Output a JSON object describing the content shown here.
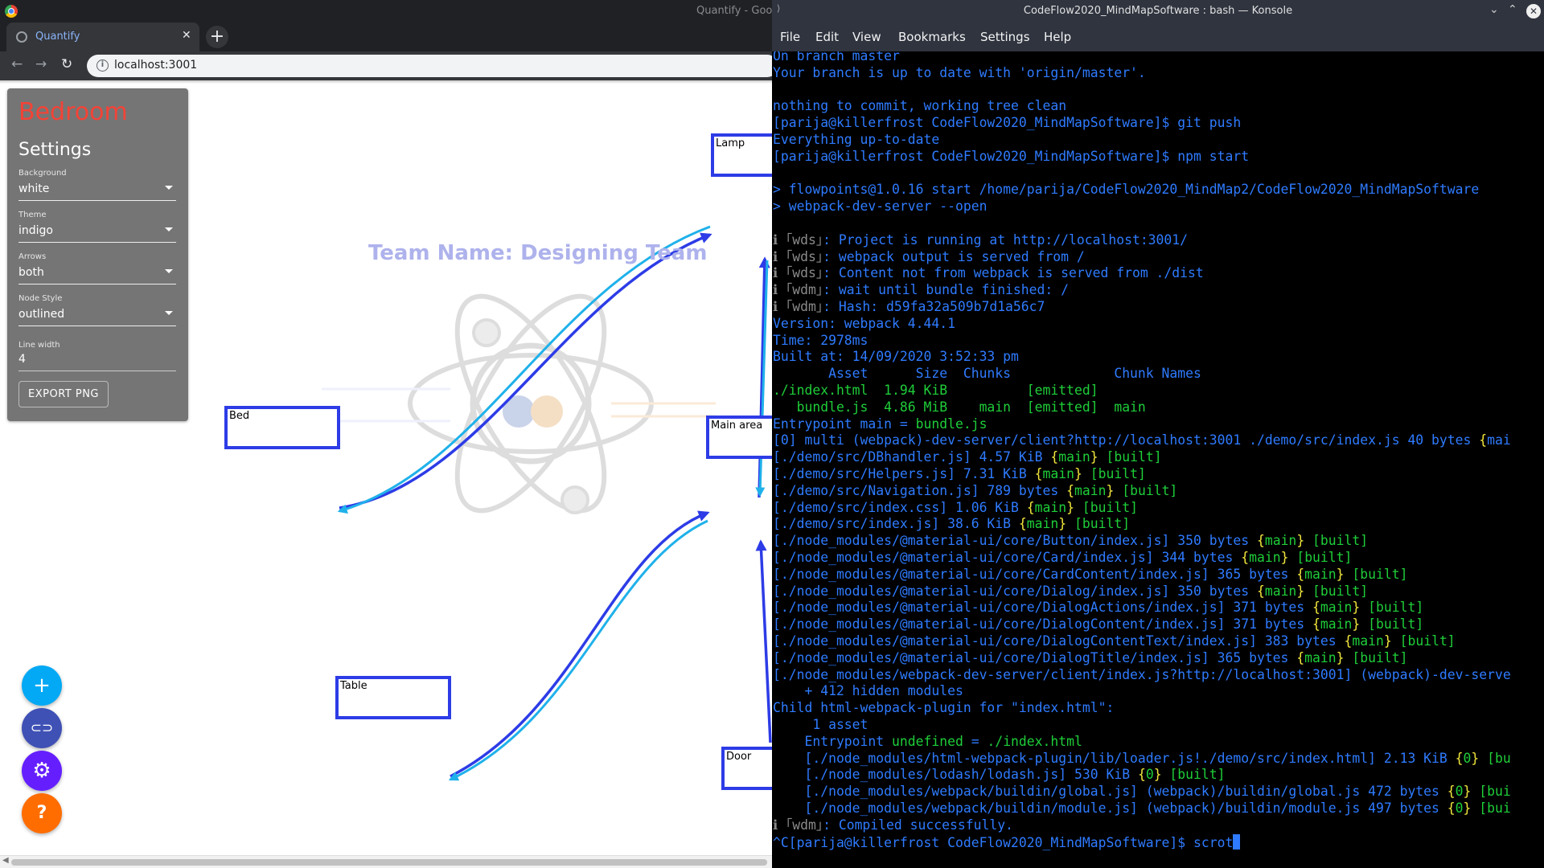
{
  "chrome": {
    "window_title": "Quantify - Goog",
    "tab_title": "Quantify",
    "url": "localhost:3001"
  },
  "app": {
    "settings": {
      "title": "Bedroom",
      "subtitle": "Settings",
      "fields": [
        {
          "label": "Background",
          "value": "white"
        },
        {
          "label": "Theme",
          "value": "indigo"
        },
        {
          "label": "Arrows",
          "value": "both"
        },
        {
          "label": "Node Style",
          "value": "outlined"
        }
      ],
      "line_width_label": "Line width",
      "line_width_value": "4",
      "export_label": "EXPORT PNG"
    },
    "team_name": "Team Name: Designing Team",
    "nodes": [
      "Lamp",
      "Bed",
      "Main area",
      "Table",
      "Door"
    ],
    "fabs": [
      {
        "icon": "plus-icon",
        "glyph": "+",
        "color": "#03a9f4"
      },
      {
        "icon": "link-icon",
        "glyph": "⊂⊃",
        "color": "#3f51b5"
      },
      {
        "icon": "gear-icon",
        "glyph": "⚙",
        "color": "#651fff"
      },
      {
        "icon": "help-icon",
        "glyph": "?",
        "color": "#ff6d00"
      }
    ],
    "colors": {
      "node_border": "#2d3ce6",
      "arrow_dark": "#2d3ce6",
      "arrow_light": "#1fb1ea",
      "accent_title": "#f44336"
    }
  },
  "konsole": {
    "title": "CodeFlow2020_MindMapSoftware : bash — Konsole",
    "menu": [
      "File",
      "Edit",
      "View",
      "Bookmarks",
      "Settings",
      "Help"
    ],
    "lines": [
      [
        [
          "c-blue",
          "On branch master"
        ]
      ],
      [
        [
          "c-blue",
          "Your branch is up to date with 'origin/master'."
        ]
      ],
      [
        [
          "c-blue",
          ""
        ]
      ],
      [
        [
          "c-blue",
          "nothing to commit, working tree clean"
        ]
      ],
      [
        [
          "c-blue",
          "[parija@killerfrost CodeFlow2020_MindMapSoftware]$ git push"
        ]
      ],
      [
        [
          "c-blue",
          "Everything up-to-date"
        ]
      ],
      [
        [
          "c-blue",
          "[parija@killerfrost CodeFlow2020_MindMapSoftware]$ npm start"
        ]
      ],
      [
        [
          "c-blue",
          ""
        ]
      ],
      [
        [
          "c-blue",
          "> flowpoints@1.0.16 start /home/parija/CodeFlow2020_MindMap2/CodeFlow2020_MindMapSoftware"
        ]
      ],
      [
        [
          "c-blue",
          "> webpack-dev-server --open"
        ]
      ],
      [
        [
          "c-blue",
          ""
        ]
      ],
      [
        [
          "c-gray",
          "ℹ ｢wds｣"
        ],
        [
          "c-blue",
          ": Project is running at http://localhost:3001/"
        ]
      ],
      [
        [
          "c-gray",
          "ℹ ｢wds｣"
        ],
        [
          "c-blue",
          ": webpack output is served from /"
        ]
      ],
      [
        [
          "c-gray",
          "ℹ ｢wds｣"
        ],
        [
          "c-blue",
          ": Content not from webpack is served from ./dist"
        ]
      ],
      [
        [
          "c-gray",
          "ℹ ｢wdm｣"
        ],
        [
          "c-blue",
          ": wait until bundle finished: /"
        ]
      ],
      [
        [
          "c-gray",
          "ℹ ｢wdm｣"
        ],
        [
          "c-blue",
          ": Hash: d59fa32a509b7d1a56c7"
        ]
      ],
      [
        [
          "c-blue",
          "Version: webpack 4.44.1"
        ]
      ],
      [
        [
          "c-blue",
          "Time: 2978ms"
        ]
      ],
      [
        [
          "c-blue",
          "Built at: 14/09/2020 3:52:33 pm"
        ]
      ],
      [
        [
          "c-blue",
          "       Asset      Size  Chunks             Chunk Names"
        ]
      ],
      [
        [
          "c-green",
          "./index.html  1.94 KiB          [emitted]"
        ]
      ],
      [
        [
          "c-green",
          "   bundle.js  4.86 MiB    main  [emitted]  main"
        ]
      ],
      [
        [
          "c-blue",
          "Entrypoint main = "
        ],
        [
          "c-green",
          "bundle.js"
        ]
      ],
      [
        [
          "c-blue",
          "[0] multi (webpack)-dev-server/client?http://localhost:3001 ./demo/src/index.js 40 bytes "
        ],
        [
          "c-yellow",
          "{"
        ],
        [
          "c-blue",
          "mai"
        ]
      ],
      [
        [
          "c-blue",
          "[./demo/src/DBhandler.js] 4.57 KiB "
        ],
        [
          "c-yellow",
          "{"
        ],
        [
          "c-green",
          "main"
        ],
        [
          "c-yellow",
          "}"
        ],
        [
          "c-green",
          " [built]"
        ]
      ],
      [
        [
          "c-blue",
          "[./demo/src/Helpers.js] 7.31 KiB "
        ],
        [
          "c-yellow",
          "{"
        ],
        [
          "c-green",
          "main"
        ],
        [
          "c-yellow",
          "}"
        ],
        [
          "c-green",
          " [built]"
        ]
      ],
      [
        [
          "c-blue",
          "[./demo/src/Navigation.js] 789 bytes "
        ],
        [
          "c-yellow",
          "{"
        ],
        [
          "c-green",
          "main"
        ],
        [
          "c-yellow",
          "}"
        ],
        [
          "c-green",
          " [built]"
        ]
      ],
      [
        [
          "c-blue",
          "[./demo/src/index.css] 1.06 KiB "
        ],
        [
          "c-yellow",
          "{"
        ],
        [
          "c-green",
          "main"
        ],
        [
          "c-yellow",
          "}"
        ],
        [
          "c-green",
          " [built]"
        ]
      ],
      [
        [
          "c-blue",
          "[./demo/src/index.js] 38.6 KiB "
        ],
        [
          "c-yellow",
          "{"
        ],
        [
          "c-green",
          "main"
        ],
        [
          "c-yellow",
          "}"
        ],
        [
          "c-green",
          " [built]"
        ]
      ],
      [
        [
          "c-blue",
          "[./node_modules/@material-ui/core/Button/index.js] 350 bytes "
        ],
        [
          "c-yellow",
          "{"
        ],
        [
          "c-green",
          "main"
        ],
        [
          "c-yellow",
          "}"
        ],
        [
          "c-green",
          " [built]"
        ]
      ],
      [
        [
          "c-blue",
          "[./node_modules/@material-ui/core/Card/index.js] 344 bytes "
        ],
        [
          "c-yellow",
          "{"
        ],
        [
          "c-green",
          "main"
        ],
        [
          "c-yellow",
          "}"
        ],
        [
          "c-green",
          " [built]"
        ]
      ],
      [
        [
          "c-blue",
          "[./node_modules/@material-ui/core/CardContent/index.js] 365 bytes "
        ],
        [
          "c-yellow",
          "{"
        ],
        [
          "c-green",
          "main"
        ],
        [
          "c-yellow",
          "}"
        ],
        [
          "c-green",
          " [built]"
        ]
      ],
      [
        [
          "c-blue",
          "[./node_modules/@material-ui/core/Dialog/index.js] 350 bytes "
        ],
        [
          "c-yellow",
          "{"
        ],
        [
          "c-green",
          "main"
        ],
        [
          "c-yellow",
          "}"
        ],
        [
          "c-green",
          " [built]"
        ]
      ],
      [
        [
          "c-blue",
          "[./node_modules/@material-ui/core/DialogActions/index.js] 371 bytes "
        ],
        [
          "c-yellow",
          "{"
        ],
        [
          "c-green",
          "main"
        ],
        [
          "c-yellow",
          "}"
        ],
        [
          "c-green",
          " [built]"
        ]
      ],
      [
        [
          "c-blue",
          "[./node_modules/@material-ui/core/DialogContent/index.js] 371 bytes "
        ],
        [
          "c-yellow",
          "{"
        ],
        [
          "c-green",
          "main"
        ],
        [
          "c-yellow",
          "}"
        ],
        [
          "c-green",
          " [built]"
        ]
      ],
      [
        [
          "c-blue",
          "[./node_modules/@material-ui/core/DialogContentText/index.js] 383 bytes "
        ],
        [
          "c-yellow",
          "{"
        ],
        [
          "c-green",
          "main"
        ],
        [
          "c-yellow",
          "}"
        ],
        [
          "c-green",
          " [built]"
        ]
      ],
      [
        [
          "c-blue",
          "[./node_modules/@material-ui/core/DialogTitle/index.js] 365 bytes "
        ],
        [
          "c-yellow",
          "{"
        ],
        [
          "c-green",
          "main"
        ],
        [
          "c-yellow",
          "}"
        ],
        [
          "c-green",
          " [built]"
        ]
      ],
      [
        [
          "c-blue",
          "[./node_modules/webpack-dev-server/client/index.js?http://localhost:3001] (webpack)-dev-serve"
        ]
      ],
      [
        [
          "c-blue",
          "    + 412 hidden modules"
        ]
      ],
      [
        [
          "c-blue",
          "Child html-webpack-plugin for \"index.html\":"
        ]
      ],
      [
        [
          "c-blue",
          "     1 asset"
        ]
      ],
      [
        [
          "c-blue",
          "    Entrypoint "
        ],
        [
          "c-green",
          "undefined"
        ],
        [
          "c-blue",
          " = "
        ],
        [
          "c-green",
          "./index.html"
        ]
      ],
      [
        [
          "c-blue",
          "    [./node_modules/html-webpack-plugin/lib/loader.js!./demo/src/index.html] 2.13 KiB "
        ],
        [
          "c-yellow",
          "{"
        ],
        [
          "c-green",
          "0"
        ],
        [
          "c-yellow",
          "}"
        ],
        [
          "c-green",
          " [bu"
        ]
      ],
      [
        [
          "c-blue",
          "    [./node_modules/lodash/lodash.js] 530 KiB "
        ],
        [
          "c-yellow",
          "{"
        ],
        [
          "c-green",
          "0"
        ],
        [
          "c-yellow",
          "}"
        ],
        [
          "c-green",
          " [built]"
        ]
      ],
      [
        [
          "c-blue",
          "    [./node_modules/webpack/buildin/global.js] (webpack)/buildin/global.js 472 bytes "
        ],
        [
          "c-yellow",
          "{"
        ],
        [
          "c-green",
          "0"
        ],
        [
          "c-yellow",
          "}"
        ],
        [
          "c-green",
          " [bui"
        ]
      ],
      [
        [
          "c-blue",
          "    [./node_modules/webpack/buildin/module.js] (webpack)/buildin/module.js 497 bytes "
        ],
        [
          "c-yellow",
          "{"
        ],
        [
          "c-green",
          "0"
        ],
        [
          "c-yellow",
          "}"
        ],
        [
          "c-green",
          " [bui"
        ]
      ],
      [
        [
          "c-gray",
          "ℹ ｢wdm｣"
        ],
        [
          "c-blue",
          ": Compiled successfully."
        ]
      ],
      [
        [
          "c-blue",
          "^C[parija@killerfrost CodeFlow2020_MindMapSoftware]$ scrot"
        ]
      ]
    ]
  }
}
